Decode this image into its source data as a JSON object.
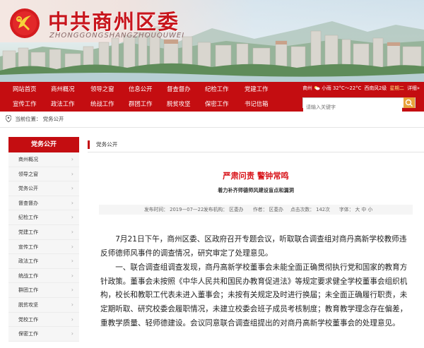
{
  "site": {
    "title": "中共商州区委",
    "subtitle": "ZHONGGONGSHANGZHOUQUWEI"
  },
  "nav": {
    "row1": [
      "网站首页",
      "商州概况",
      "领导之窗",
      "信息公开",
      "督查督办",
      "纪检工作",
      "党建工作"
    ],
    "row2": [
      "宣传工作",
      "政法工作",
      "统战工作",
      "群团工作",
      "脱贫攻坚",
      "保密工作",
      "书记信箱"
    ],
    "weather_city": "商州",
    "weather_icon": "cloud-sun-icon",
    "weather_desc": "小雨",
    "weather_temp": "32°C～22°C",
    "weather_wind": "西南风2级",
    "weekday": "星期二",
    "detail_link": "详细»",
    "search_placeholder": "请输入关键字"
  },
  "breadcrumb": {
    "label": "当前位置：",
    "current": "党务公开"
  },
  "sidebar": {
    "heading": "党务公开",
    "items": [
      "商州概况",
      "领导之窗",
      "党务公开",
      "督查督办",
      "纪检工作",
      "党建工作",
      "宣传工作",
      "政法工作",
      "统战工作",
      "群团工作",
      "脱贫攻坚",
      "党校工作",
      "保密工作"
    ]
  },
  "main": {
    "section": "党务公开"
  },
  "article": {
    "title": "严肃问责 警钟常鸣",
    "subtitle": "着力补齐师德师风建设盲点和漏洞",
    "meta": {
      "date": "发布时间： 2019—07—22",
      "unit": "发布机构： 区委办",
      "author": "作者： 区委办",
      "views": "点击次数： 142次",
      "font": "字体： 大  中  小"
    },
    "paragraphs": [
      "7月21日下午，商州区委、区政府召开专题会议，听取联合调查组对商丹高新学校教师违反师德师风事件的调查情况，研究审定了处理意见。",
      "一、联合调查组调查发现，商丹高新学校董事会未能全面正确贯彻执行党和国家的教育方针政策。董事会未按照《中华人民共和国民办教育促进法》等规定要求健全学校董事会组织机构，校长和教职工代表未进入董事会；未按有关规定及时进行换届；未全面正确履行职责，未定期听取、研究校委会履职情况，未建立校委会班子成员考核制度；教育教学理念存在偏差，重教学质量、轻师德建设。会议同意联合调查组提出的对商丹高新学校董事会的处理意见。"
    ]
  },
  "colors": {
    "brand_red": "#c40d11",
    "title_red": "#d8141a",
    "search_button": "#e8a23c"
  }
}
